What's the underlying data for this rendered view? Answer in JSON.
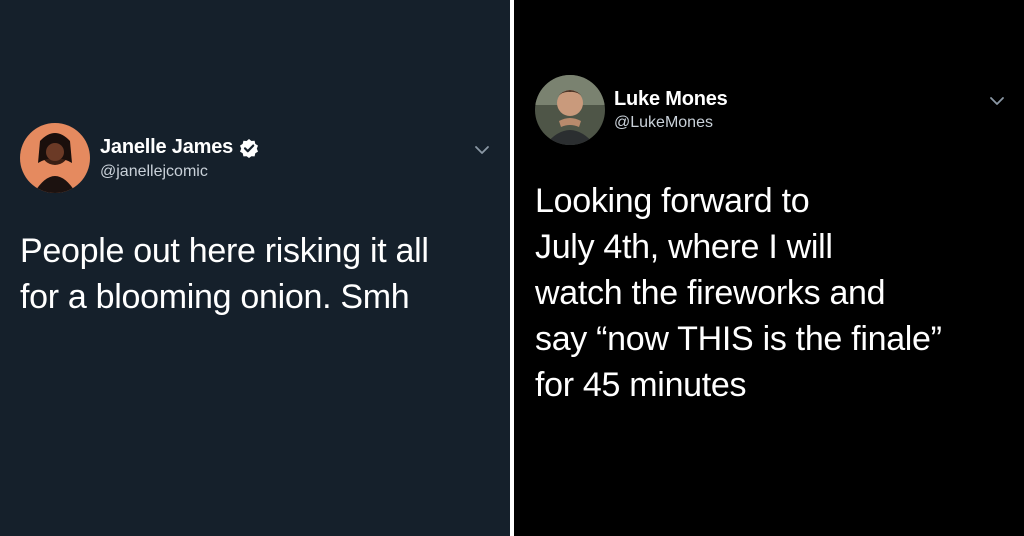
{
  "tweets": [
    {
      "display_name": "Janelle James",
      "handle": "@janellejcomic",
      "verified": true,
      "avatar_icon": "profile-photo-icon",
      "menu_icon": "chevron-down-icon",
      "text": "People out here risking it all\nfor a blooming onion. Smh",
      "theme_background": "#15202b"
    },
    {
      "display_name": "Luke Mones",
      "handle": "@LukeMones",
      "verified": false,
      "avatar_icon": "profile-photo-icon",
      "menu_icon": "chevron-down-icon",
      "text": "Looking forward to\nJuly 4th, where I will\nwatch the fireworks and\nsay “now THIS is the finale”\nfor 45 minutes",
      "theme_background": "#000000"
    }
  ],
  "colors": {
    "text_primary": "#ffffff",
    "text_secondary": "#c9d1d9",
    "divider": "#ffffff"
  }
}
